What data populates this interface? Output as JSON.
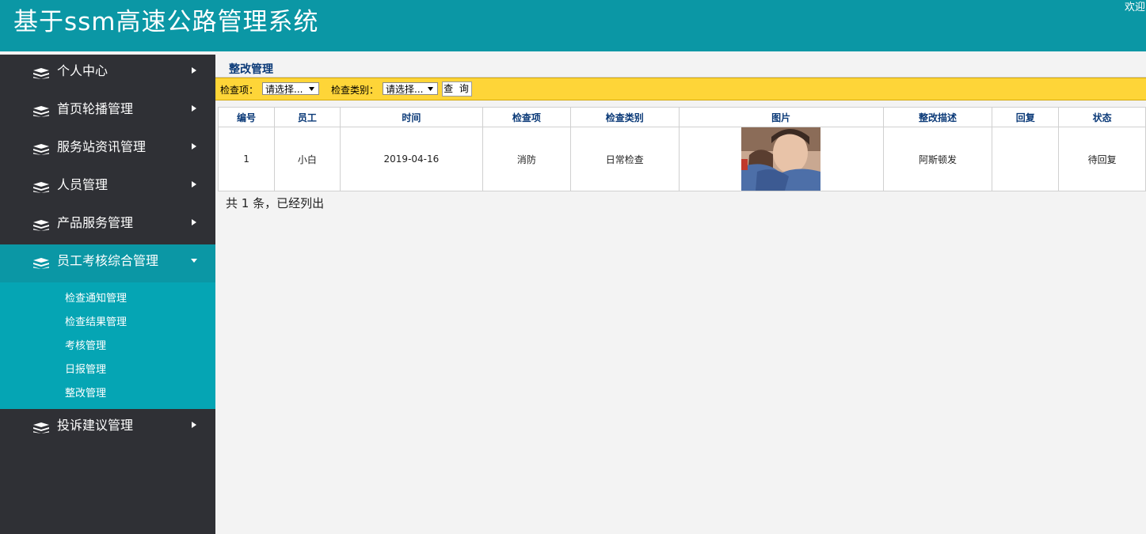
{
  "header": {
    "app_title": "基于ssm高速公路管理系统",
    "welcome": "欢迎"
  },
  "sidebar": {
    "items": [
      {
        "label": "个人中心"
      },
      {
        "label": "首页轮播管理"
      },
      {
        "label": "服务站资讯管理"
      },
      {
        "label": "人员管理"
      },
      {
        "label": "产品服务管理"
      },
      {
        "label": "员工考核综合管理",
        "expanded": true,
        "children": [
          "检查通知管理",
          "检查结果管理",
          "考核管理",
          "日报管理",
          "整改管理"
        ]
      },
      {
        "label": "投诉建议管理"
      }
    ]
  },
  "page": {
    "title": "整改管理",
    "filters": {
      "check_item_label": "检查项：",
      "check_item_value": "请选择...",
      "check_type_label": "检查类别：",
      "check_type_value": "请选择...",
      "query_button": "查 询"
    },
    "table": {
      "headers": [
        "编号",
        "员工",
        "时间",
        "检查项",
        "检查类别",
        "图片",
        "整改描述",
        "回复",
        "状态"
      ],
      "rows": [
        {
          "id": "1",
          "employee": "小白",
          "date": "2019-04-16",
          "check_item": "消防",
          "check_type": "日常检查",
          "image": "photo",
          "description": "阿斯顿发",
          "reply": "",
          "status": "待回复"
        }
      ]
    },
    "summary": "共 1 条，已经列出"
  },
  "colors": {
    "header_bg": "#0b97a5",
    "sidebar_bg": "#2f3035",
    "submenu_bg": "#05a5b4",
    "filterbar_bg": "#fed538",
    "title_text": "#0b3a78"
  }
}
